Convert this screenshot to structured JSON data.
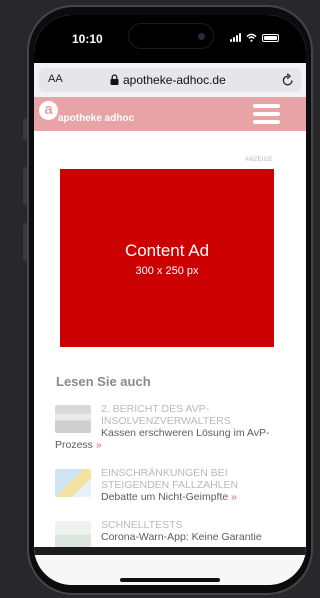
{
  "status": {
    "time": "10:10"
  },
  "browser": {
    "text_size_label": "AA",
    "url": "apotheke-adhoc.de"
  },
  "site": {
    "logo_letter": "a",
    "name": "apotheke adhoc"
  },
  "ad": {
    "label": "ANZEIGE",
    "title": "Content Ad",
    "size": "300 x 250 px"
  },
  "read_more": {
    "title": "Lesen Sie auch",
    "articles": [
      {
        "kicker": "2. BERICHT DES AVP-INSOLVENZVERWALTERS",
        "headline": "Kassen erschweren Lösung im AvP-Prozess",
        "more": "»"
      },
      {
        "kicker": "EINSCHRÄNKUNGEN BEI STEIGENDEN FALLZAHLEN",
        "headline": "Debatte um Nicht-Geimpfte",
        "more": "»"
      },
      {
        "kicker": "SCHNELLTESTS",
        "headline": "Corona-Warn-App: Keine Garantie",
        "more": ""
      }
    ]
  },
  "colors": {
    "brand": "#e8a3a6",
    "ad_background": "#cc0000",
    "link_arrow": "#e0606a"
  },
  "icons": [
    "lock-icon",
    "reload-icon",
    "hamburger-menu-icon",
    "signal-icon",
    "wifi-icon",
    "battery-icon"
  ]
}
